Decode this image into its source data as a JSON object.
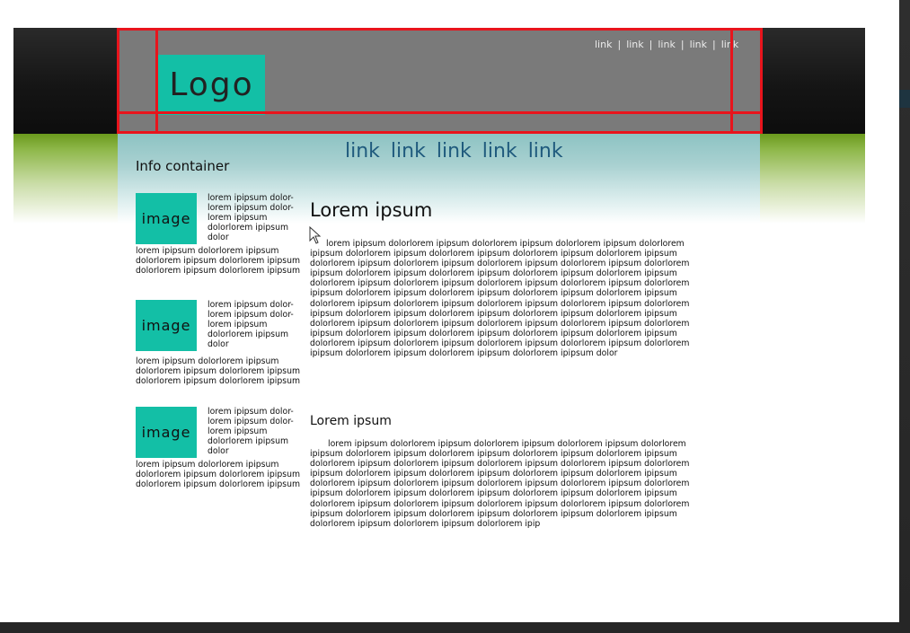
{
  "header": {
    "logo_text": "Logo",
    "top_links": [
      "link",
      "link",
      "link",
      "link",
      "link"
    ],
    "top_link_separator": "|"
  },
  "nav": {
    "links": [
      "link",
      "link",
      "link",
      "link",
      "link"
    ]
  },
  "sidebar": {
    "title": "Info container",
    "items": [
      {
        "image_label": "image",
        "side_text": "lorem ipipsum dolor- lorem ipipsum dolor- lorem ipipsum dolorlorem ipipsum dolor",
        "under_text": "lorem ipipsum dolorlorem ipipsum dolorlorem ipipsum dolorlorem ipipsum dolorlorem ipipsum dolorlorem ipipsum"
      },
      {
        "image_label": "image",
        "side_text": "lorem ipipsum dolor- lorem ipipsum dolor- lorem ipipsum dolorlorem ipipsum dolor",
        "under_text": "lorem ipipsum dolorlorem ipipsum dolorlorem ipipsum dolorlorem ipipsum dolorlorem ipipsum dolorlorem ipipsum"
      },
      {
        "image_label": "image",
        "side_text": "lorem ipipsum dolor- lorem ipipsum dolor- lorem ipipsum dolorlorem ipipsum dolor",
        "under_text": "lorem ipipsum dolorlorem ipipsum dolorlorem ipipsum dolorlorem ipipsum dolorlorem ipipsum dolorlorem ipipsum"
      }
    ]
  },
  "main": {
    "heading": "Lorem ipsum",
    "paragraph": "lorem ipipsum dolorlorem ipipsum dolorlorem ipipsum dolorlorem ipipsum dolorlorem ipipsum dolorlorem ipipsum dolorlorem ipipsum dolorlorem ipipsum dolorlorem ipipsum dolorlorem ipipsum dolorlorem ipipsum dolorlorem ipipsum dolorlorem ipipsum dolorlorem ipipsum dolorlorem ipipsum dolorlorem ipipsum dolorlorem ipipsum dolorlorem ipipsum dolorlorem ipipsum dolorlorem ipipsum dolorlorem ipipsum dolorlorem ipipsum dolorlorem ipipsum dolorlorem ipipsum dolorlorem ipipsum dolorlorem ipipsum dolorlorem ipipsum dolorlorem ipipsum dolorlorem ipipsum dolorlorem ipipsum dolorlorem ipipsum dolorlorem ipipsum dolorlorem ipipsum dolorlorem ipipsum dolorlorem ipipsum dolorlorem ipipsum dolorlorem ipipsum dolorlorem ipipsum dolorlorem ipipsum dolorlorem ipipsum dolorlorem ipipsum dolorlorem ipipsum dolorlorem ipipsum dolorlorem ipipsum dolorlorem ipipsum dolorlorem ipipsum dolorlorem ipipsum dolorlorem ipipsum dolorlorem ipipsum dolorlorem ipipsum dolorlorem ipipsum dolorlorem ipipsum dolorlorem ipipsum dolor",
    "subheading": "Lorem ipsum",
    "subparagraph": "lorem ipipsum dolorlorem ipipsum dolorlorem ipipsum dolorlorem ipipsum dolorlorem ipipsum dolorlorem ipipsum dolorlorem ipipsum dolorlorem ipipsum dolorlorem ipipsum dolorlorem ipipsum dolorlorem ipipsum dolorlorem ipipsum dolorlorem ipipsum dolorlorem ipipsum dolorlorem ipipsum dolorlorem ipipsum dolorlorem ipipsum dolorlorem ipipsum dolorlorem ipipsum dolorlorem ipipsum dolorlorem ipipsum dolorlorem ipipsum dolorlorem ipipsum dolorlorem ipipsum dolorlorem ipipsum dolorlorem ipipsum dolorlorem ipipsum dolorlorem ipipsum dolorlorem ipipsum dolorlorem ipipsum dolorlorem ipipsum dolorlorem ipipsum dolorlorem ipipsum dolorlorem ipipsum dolorlorem ipipsum dolorlorem ipipsum dolorlorem ipipsum dolorlorem ipipsum dolorlorem ipip"
  },
  "colors": {
    "logo_bg": "#13bfa6",
    "nav_link": "#1f5a7d",
    "annotation_red": "#e8141c",
    "header_gray": "#7a7a7a",
    "green_band": "#6b9a1d"
  }
}
